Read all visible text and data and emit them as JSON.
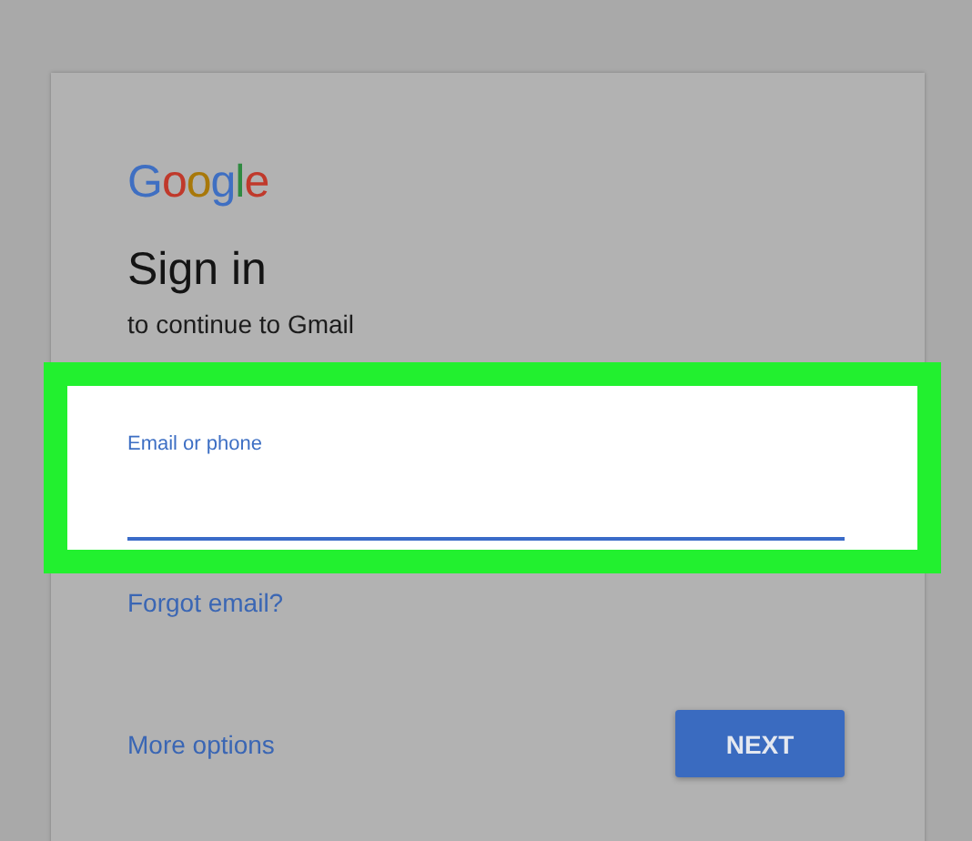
{
  "logo": "Google",
  "title": "Sign in",
  "subtitle": "to continue to Gmail",
  "email_field": {
    "label": "Email or phone",
    "highlighted": true
  },
  "forgot_link": "Forgot email?",
  "more_options_link": "More options",
  "next_button": "NEXT"
}
